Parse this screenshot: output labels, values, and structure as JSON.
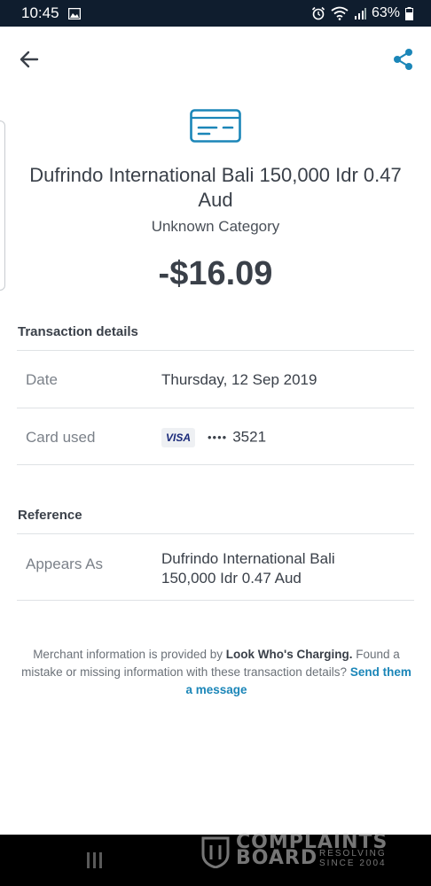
{
  "status_bar": {
    "time": "10:45",
    "battery": "63%"
  },
  "transaction": {
    "merchant_name": "Dufrindo International Bali 150,000 Idr 0.47 Aud",
    "category": "Unknown Category",
    "amount": "-$16.09"
  },
  "details": {
    "title": "Transaction details",
    "date_label": "Date",
    "date_value": "Thursday, 12 Sep 2019",
    "card_label": "Card used",
    "card_brand": "VISA",
    "card_mask": "••••",
    "card_last4": "3521"
  },
  "reference": {
    "title": "Reference",
    "appears_as_label": "Appears As",
    "appears_as_line1": "Dufrindo International Bali",
    "appears_as_line2": "150,000 Idr 0.47 Aud"
  },
  "footer": {
    "text_before": "Merchant information is provided by ",
    "provider": "Look Who's Charging.",
    "text_after": " Found a mistake or missing information with these transaction details? ",
    "link_text": "Send them a message"
  },
  "watermark": {
    "line1": "COMPLAINTS",
    "line2": "BOARD",
    "tag1": "RESOLVING",
    "tag2": "SINCE 2004"
  },
  "colors": {
    "accent": "#1b86b8",
    "status_bar": "#0f1d2e",
    "text": "#3a4049"
  }
}
